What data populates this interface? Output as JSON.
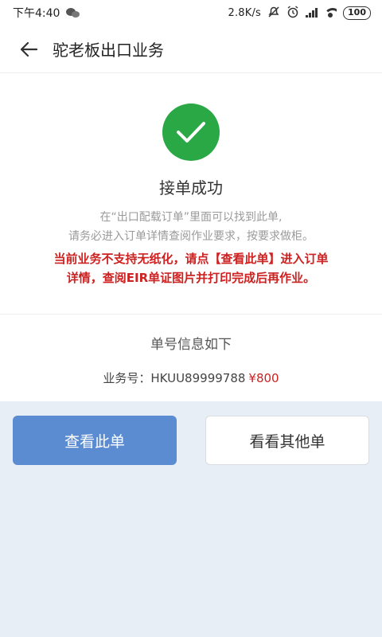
{
  "status_bar": {
    "time": "下午4:40",
    "net_speed": "2.8K/s",
    "battery": "100"
  },
  "header": {
    "title": "驼老板出口业务"
  },
  "success": {
    "title": "接单成功",
    "desc_line1": "在“出口配载订单”里面可以找到此单,",
    "desc_line2": "请务必进入订单详情查阅作业要求，按要求做柜。",
    "warning_line1": "当前业务不支持无纸化，请点【查看此单】进入订单",
    "warning_line2": "详情，查阅EIR单证图片并打印完成后再作业。"
  },
  "order_info": {
    "title": "单号信息如下",
    "label": "业务号：",
    "number": "HKUU89999788",
    "price": "¥800"
  },
  "buttons": {
    "view_order": "查看此单",
    "view_others": "看看其他单"
  },
  "colors": {
    "success_green": "#29a845",
    "primary_blue": "#5b8bd0",
    "warning_red": "#cc2222"
  }
}
